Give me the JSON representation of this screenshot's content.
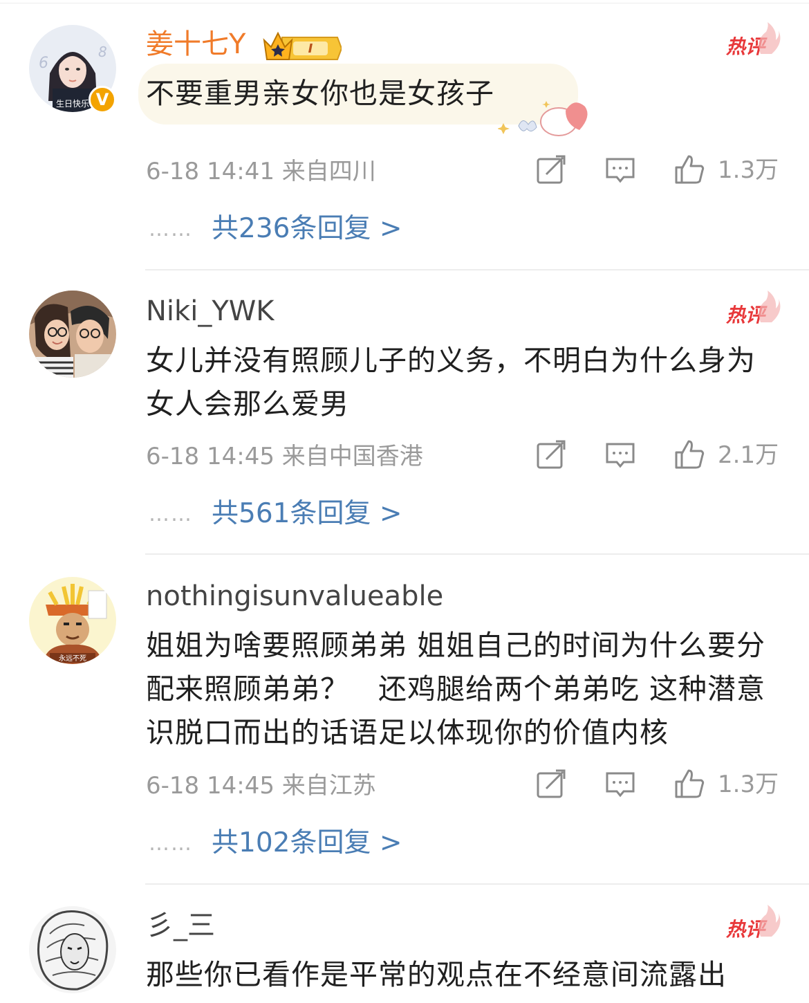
{
  "hot_label": "热评",
  "colors": {
    "username_highlight": "#f07b2a",
    "reply_link": "#4a7db4",
    "hot": "#e8383a",
    "meta": "#9a9a9a"
  },
  "comments": [
    {
      "username": "姜十七Y",
      "verified_badge": "V",
      "level_badge": "I",
      "text": "不要重男亲女你也是女孩子",
      "avatar_caption": "生日快乐",
      "meta": "6-18 14:41 来自四川",
      "likes": "1.3万",
      "replies": "共236条回复 >",
      "dots": "……"
    },
    {
      "username": "Niki_YWK",
      "text": "女儿并没有照顾儿子的义务，不明白为什么身为女人会那么爱男",
      "meta": "6-18 14:45 来自中国香港",
      "likes": "2.1万",
      "replies": "共561条回复 >",
      "dots": "……"
    },
    {
      "username": "nothingisunvalueable",
      "text": "姐姐为啥要照顾弟弟 姐姐自己的时间为什么要分配来照顾弟弟？　还鸡腿给两个弟弟吃 这种潜意识脱口而出的话语足以体现你的价值内核",
      "avatar_caption": "永远不死",
      "meta": "6-18 14:45 来自江苏",
      "likes": "1.3万",
      "replies": "共102条回复 >",
      "dots": "……"
    },
    {
      "username": "彡_三",
      "text": "那些你已看作是平常的观点在不经意间流露出"
    }
  ],
  "icons": [
    "repost-icon",
    "comment-icon",
    "like-icon"
  ]
}
